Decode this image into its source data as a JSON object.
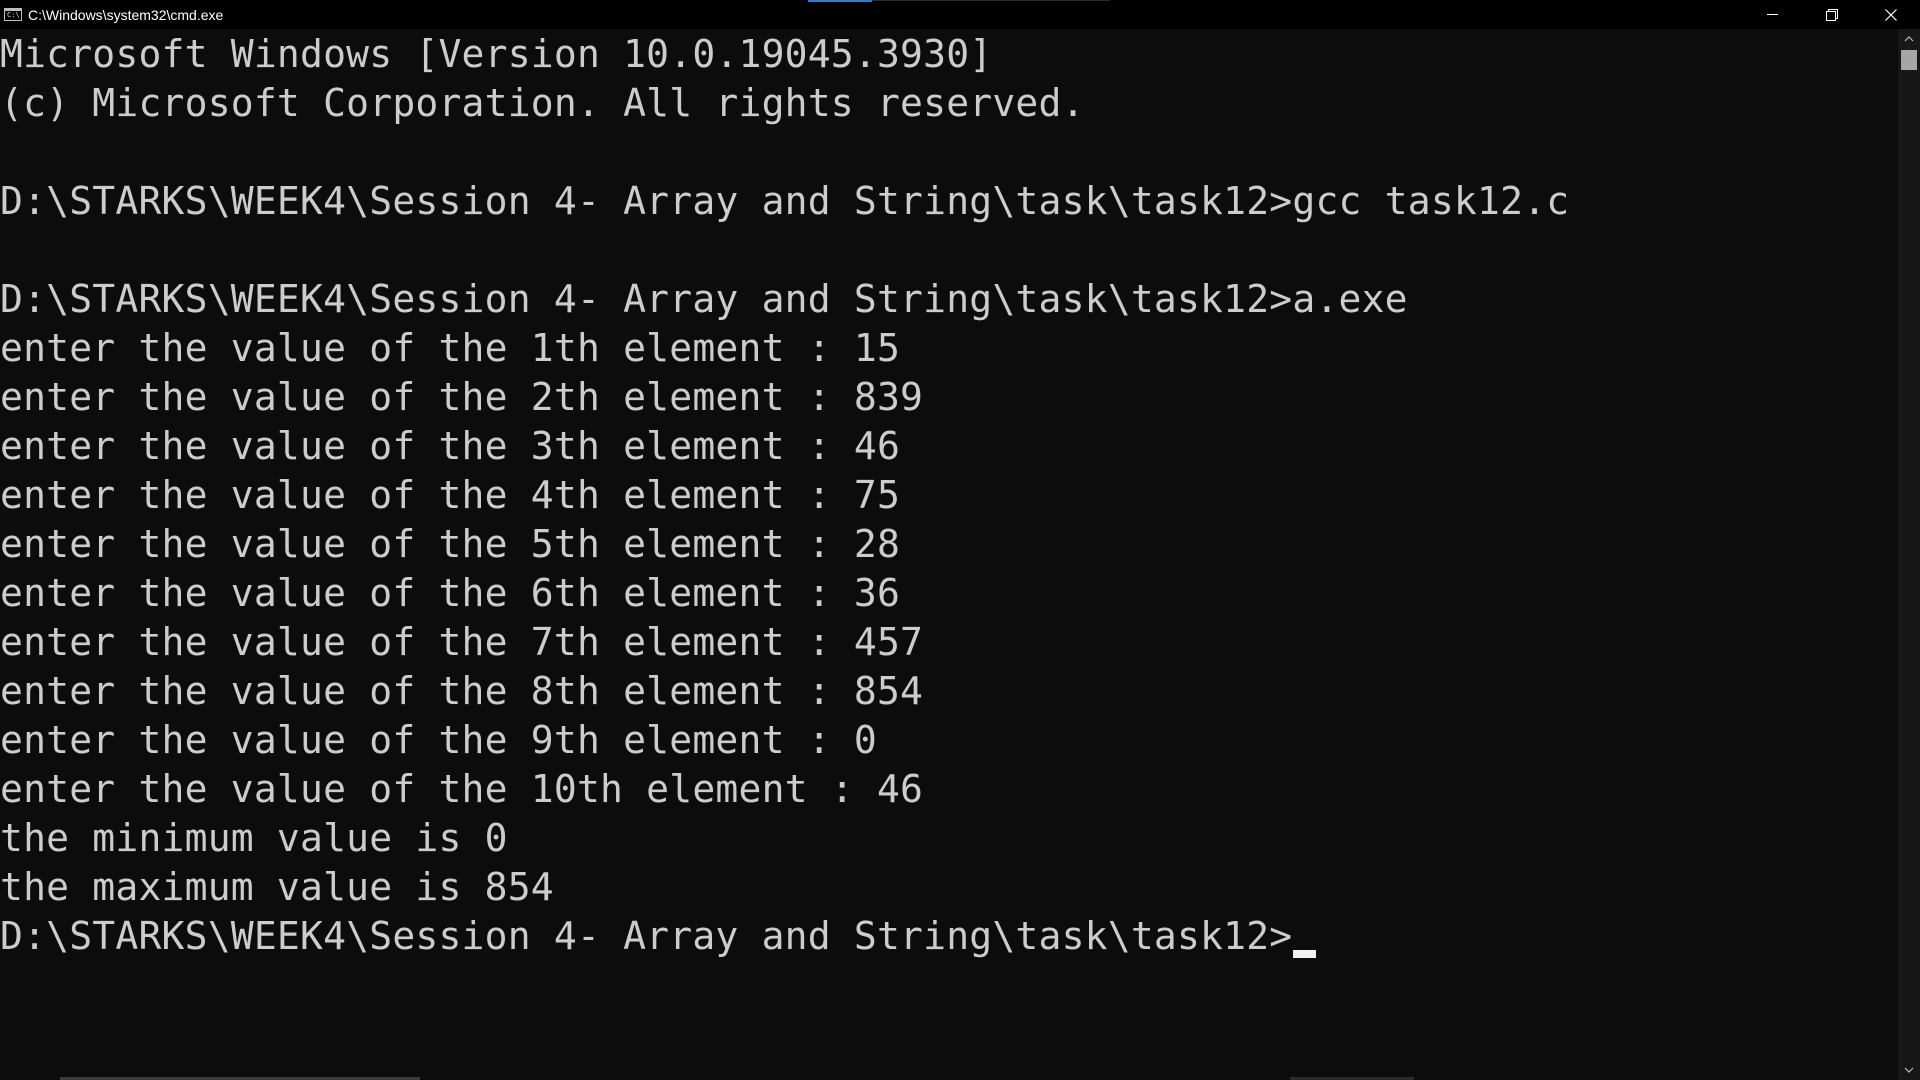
{
  "window": {
    "title": "C:\\Windows\\system32\\cmd.exe",
    "icon": "cmd-icon",
    "icon_text": "C:\\",
    "controls": [
      "minimize-icon",
      "restore-icon",
      "close-icon"
    ]
  },
  "console": {
    "foreground": "#cccccc",
    "background": "#0c0c0c",
    "lines": [
      "Microsoft Windows [Version 10.0.19045.3930]",
      "(c) Microsoft Corporation. All rights reserved.",
      "",
      "D:\\STARKS\\WEEK4\\Session 4- Array and String\\task\\task12>gcc task12.c",
      "",
      "D:\\STARKS\\WEEK4\\Session 4- Array and String\\task\\task12>a.exe",
      "enter the value of the 1th element : 15",
      "enter the value of the 2th element : 839",
      "enter the value of the 3th element : 46",
      "enter the value of the 4th element : 75",
      "enter the value of the 5th element : 28",
      "enter the value of the 6th element : 36",
      "enter the value of the 7th element : 457",
      "enter the value of the 8th element : 854",
      "enter the value of the 9th element : 0",
      "enter the value of the 10th element : 46",
      "the minimum value is 0",
      "the maximum value is 854",
      "D:\\STARKS\\WEEK4\\Session 4- Array and String\\task\\task12>"
    ]
  }
}
